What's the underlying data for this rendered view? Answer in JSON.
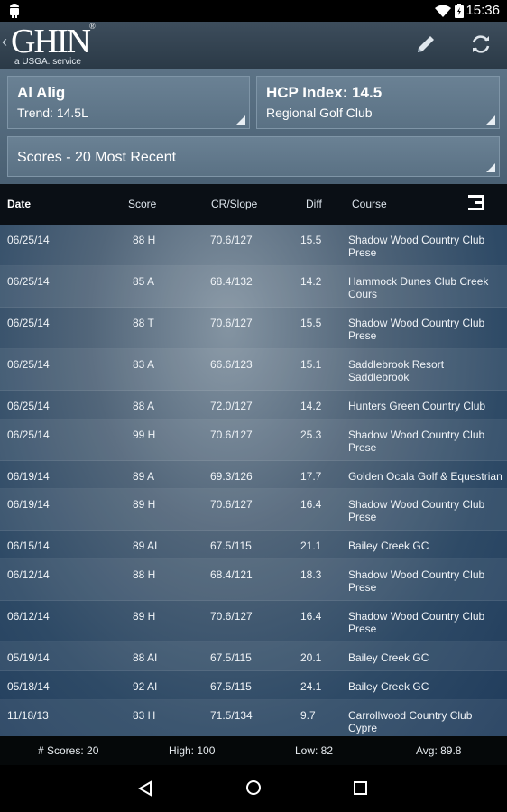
{
  "status_bar": {
    "time": "15:36"
  },
  "header": {
    "logo": "GHIN",
    "logo_reg": "®",
    "tagline": "a USGA. service"
  },
  "player": {
    "name": "Al Alig",
    "trend": "Trend: 14.5L"
  },
  "hcp": {
    "index": "HCP Index: 14.5",
    "club": "Regional Golf Club"
  },
  "scores_filter": {
    "label": "Scores - 20 Most Recent"
  },
  "table": {
    "headers": {
      "date": "Date",
      "score": "Score",
      "cr_slope": "CR/Slope",
      "diff": "Diff",
      "course": "Course"
    },
    "rows": [
      {
        "date": "06/25/14",
        "score": "88 H",
        "cr": "70.6/127",
        "diff": "15.5",
        "course": "Shadow Wood Country Club Prese"
      },
      {
        "date": "06/25/14",
        "score": "85 A",
        "cr": "68.4/132",
        "diff": "14.2",
        "course": "Hammock Dunes Club Creek Cours"
      },
      {
        "date": "06/25/14",
        "score": "88 T",
        "cr": "70.6/127",
        "diff": "15.5",
        "course": "Shadow Wood Country Club Prese"
      },
      {
        "date": "06/25/14",
        "score": "83 A",
        "cr": "66.6/123",
        "diff": "15.1",
        "course": "Saddlebrook Resort Saddlebrook"
      },
      {
        "date": "06/25/14",
        "score": "88 A",
        "cr": "72.0/127",
        "diff": "14.2",
        "course": "Hunters Green Country Club"
      },
      {
        "date": "06/25/14",
        "score": "99 H",
        "cr": "70.6/127",
        "diff": "25.3",
        "course": "Shadow Wood Country Club Prese"
      },
      {
        "date": "06/19/14",
        "score": "89 A",
        "cr": "69.3/126",
        "diff": "17.7",
        "course": "Golden Ocala Golf & Equestrian"
      },
      {
        "date": "06/19/14",
        "score": "89 H",
        "cr": "70.6/127",
        "diff": "16.4",
        "course": "Shadow Wood Country Club Prese"
      },
      {
        "date": "06/15/14",
        "score": "89 AI",
        "cr": "67.5/115",
        "diff": "21.1",
        "course": "Bailey Creek GC"
      },
      {
        "date": "06/12/14",
        "score": "88 H",
        "cr": "68.4/121",
        "diff": "18.3",
        "course": "Shadow Wood Country Club Prese"
      },
      {
        "date": "06/12/14",
        "score": "89 H",
        "cr": "70.6/127",
        "diff": "16.4",
        "course": "Shadow Wood Country Club Prese"
      },
      {
        "date": "05/19/14",
        "score": "88 AI",
        "cr": "67.5/115",
        "diff": "20.1",
        "course": "Bailey Creek GC"
      },
      {
        "date": "05/18/14",
        "score": "92 AI",
        "cr": "67.5/115",
        "diff": "24.1",
        "course": "Bailey Creek GC"
      },
      {
        "date": "11/18/13",
        "score": "83 H",
        "cr": "71.5/134",
        "diff": "9.7",
        "course": "Carrollwood Country Club Cypre"
      }
    ]
  },
  "stats": {
    "count": "# Scores: 20",
    "high": "High: 100",
    "low": "Low: 82",
    "avg": "Avg: 89.8"
  },
  "icons": {
    "edit": "pencil-icon",
    "refresh": "refresh-icon",
    "columns": "column-menu-icon",
    "nav_back": "triangle-back-icon",
    "nav_home": "circle-home-icon",
    "nav_recent": "square-recent-icon"
  },
  "colors": {
    "header": "#2b3a47",
    "panel": "#5c7386",
    "table_header": "#0a0f15",
    "footer": "#050809"
  }
}
